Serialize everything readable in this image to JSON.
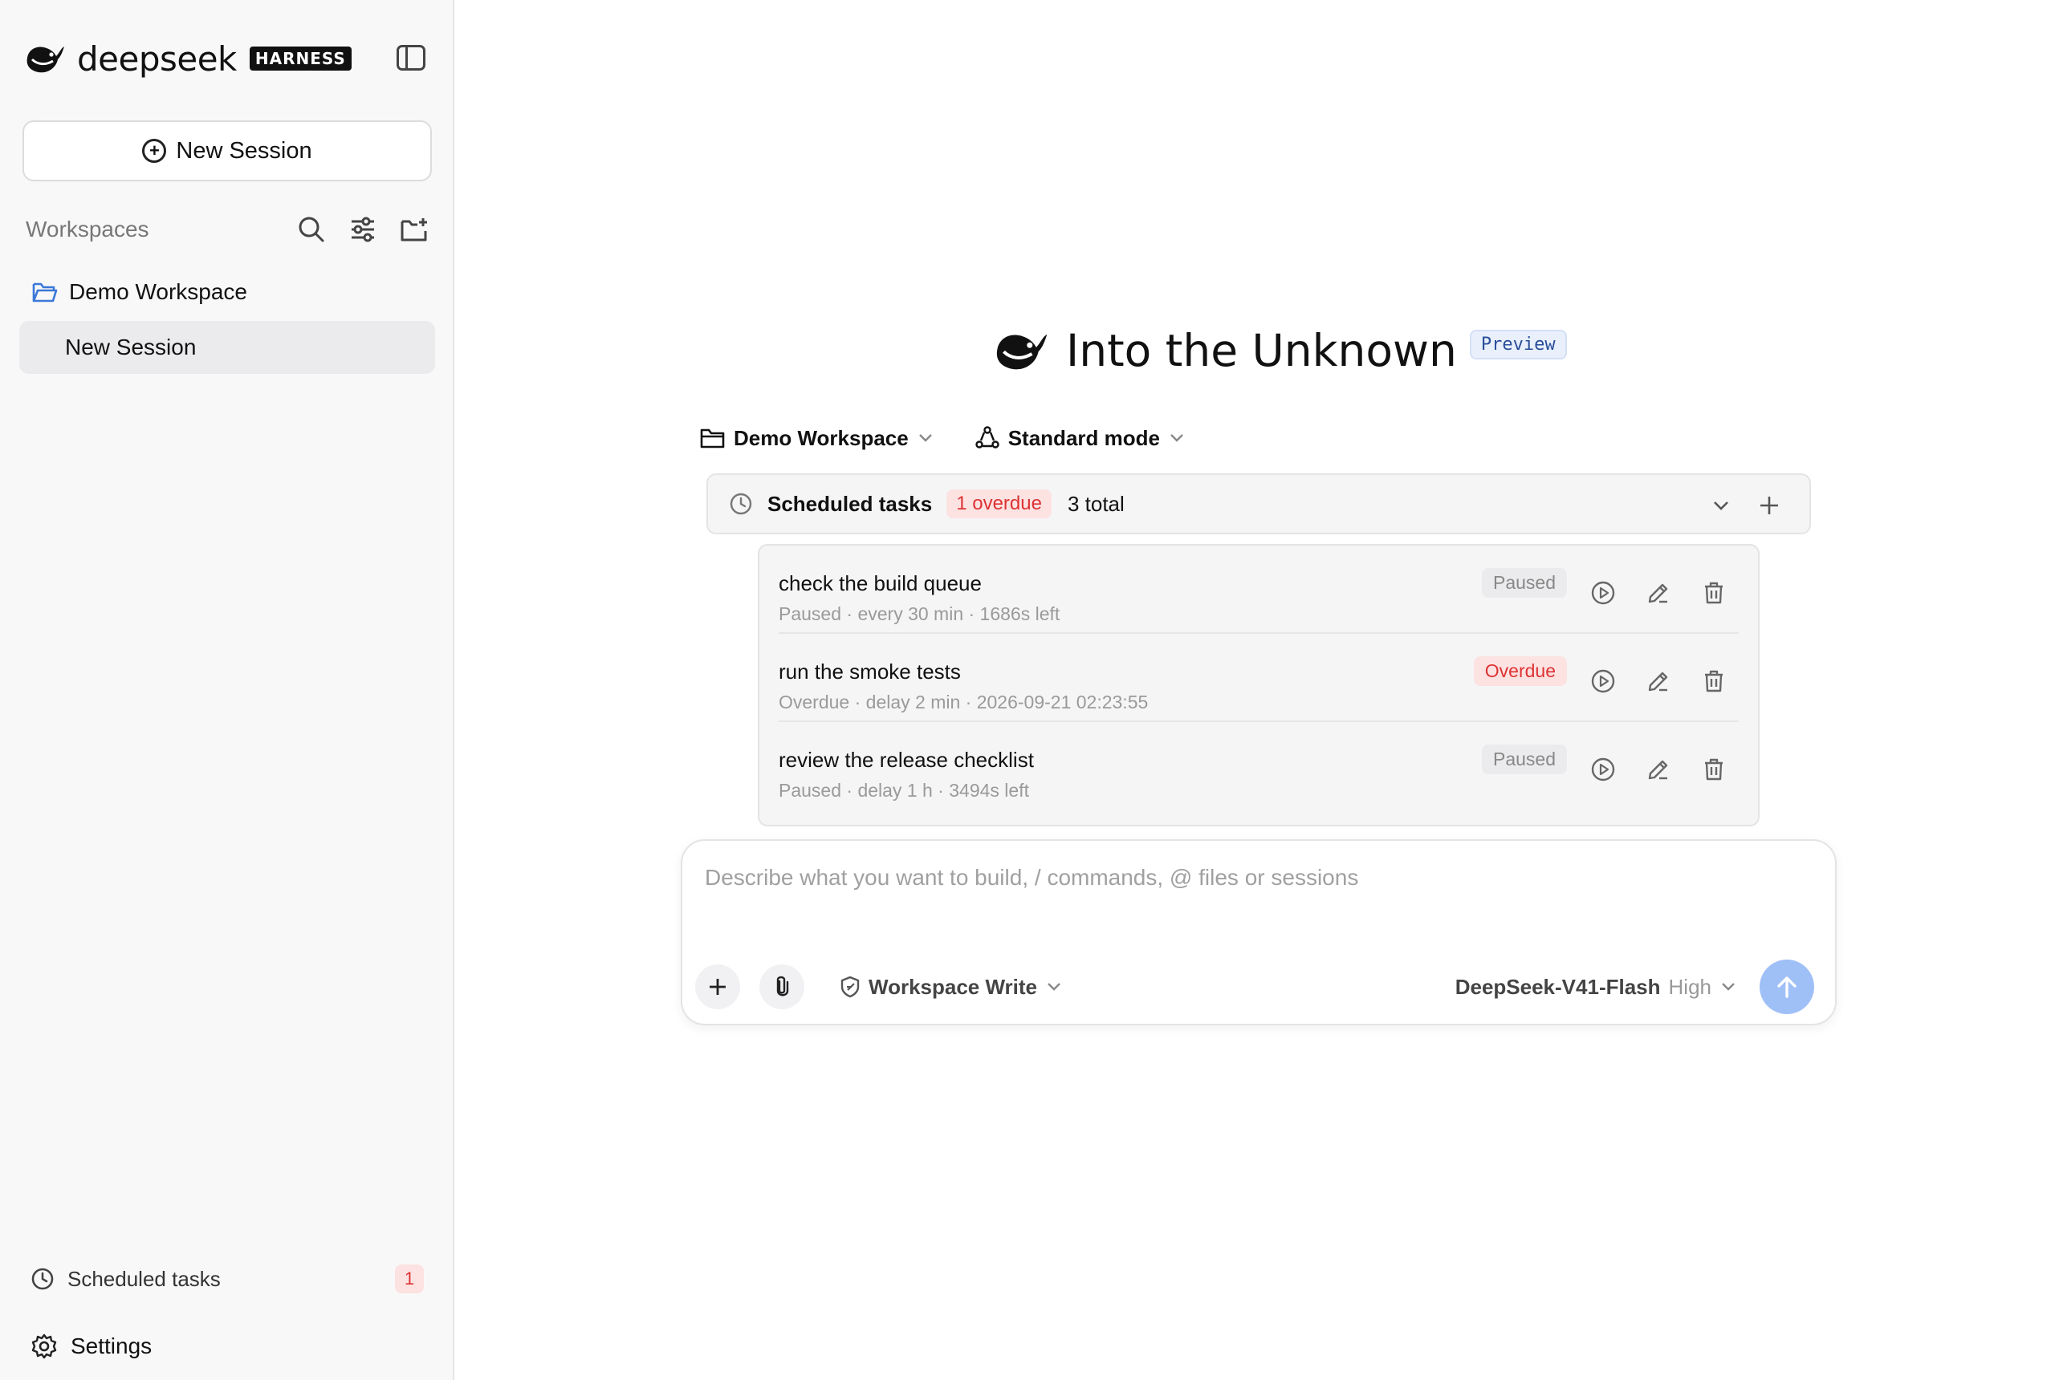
{
  "brand": {
    "name": "deepseek",
    "badge": "HARNESS"
  },
  "sidebar": {
    "new_session_label": "New Session",
    "workspaces_label": "Workspaces",
    "workspace_name": "Demo Workspace",
    "session_name": "New Session",
    "scheduled_label": "Scheduled tasks",
    "scheduled_count": "1",
    "settings_label": "Settings"
  },
  "hero": {
    "title": "Into the Unknown",
    "badge": "Preview"
  },
  "selectors": {
    "workspace": "Demo Workspace",
    "mode": "Standard mode"
  },
  "scheduled": {
    "title": "Scheduled tasks",
    "overdue": "1 overdue",
    "total": "3 total",
    "tasks": [
      {
        "title": "check the build queue",
        "meta": "Paused · every 30 min · 1686s left",
        "status": "Paused"
      },
      {
        "title": "run the smoke tests",
        "meta": "Overdue · delay 2 min · 2026-09-21 02:23:55",
        "status": "Overdue"
      },
      {
        "title": "review the release checklist",
        "meta": "Paused · delay 1 h · 3494s left",
        "status": "Paused"
      }
    ]
  },
  "composer": {
    "placeholder": "Describe what you want to build, / commands, @ files or sessions",
    "permission": "Workspace Write",
    "model": "DeepSeek-V41-Flash",
    "level": "High"
  },
  "colors": {
    "accent": "#9fbff7",
    "overdue": "#dd3333",
    "folder": "#3b78d8"
  }
}
